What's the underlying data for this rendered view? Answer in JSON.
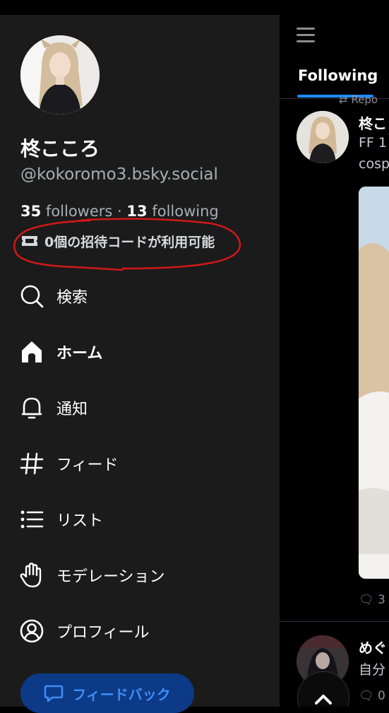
{
  "feed": {
    "tab_label": "Following",
    "repost_label": "Repo",
    "post": {
      "author": "柊こ",
      "text_line1": "FF 1",
      "text_line2": "cosp",
      "reply_count": "3"
    },
    "post2": {
      "author": "めぐ",
      "text": "自分",
      "reply_count": "0"
    }
  },
  "profile": {
    "display_name": "柊こころ",
    "handle": "@kokoromo3.bsky.social",
    "followers_count": "35",
    "followers_label": "followers",
    "separator": "·",
    "following_count": "13",
    "following_label": "following",
    "invite_codes_label": "0個の招待コードが利用可能"
  },
  "nav": {
    "search": "検索",
    "home": "ホーム",
    "notifications": "通知",
    "feeds": "フィード",
    "lists": "リスト",
    "moderation": "モデレーション",
    "profile": "プロフィール"
  },
  "feedback_button": "フィードバック",
  "colors": {
    "drawer_bg": "#1c1b1c",
    "accent": "#208bfe",
    "feedback_bg": "#0c3a87",
    "annotation_red": "#d01818"
  }
}
